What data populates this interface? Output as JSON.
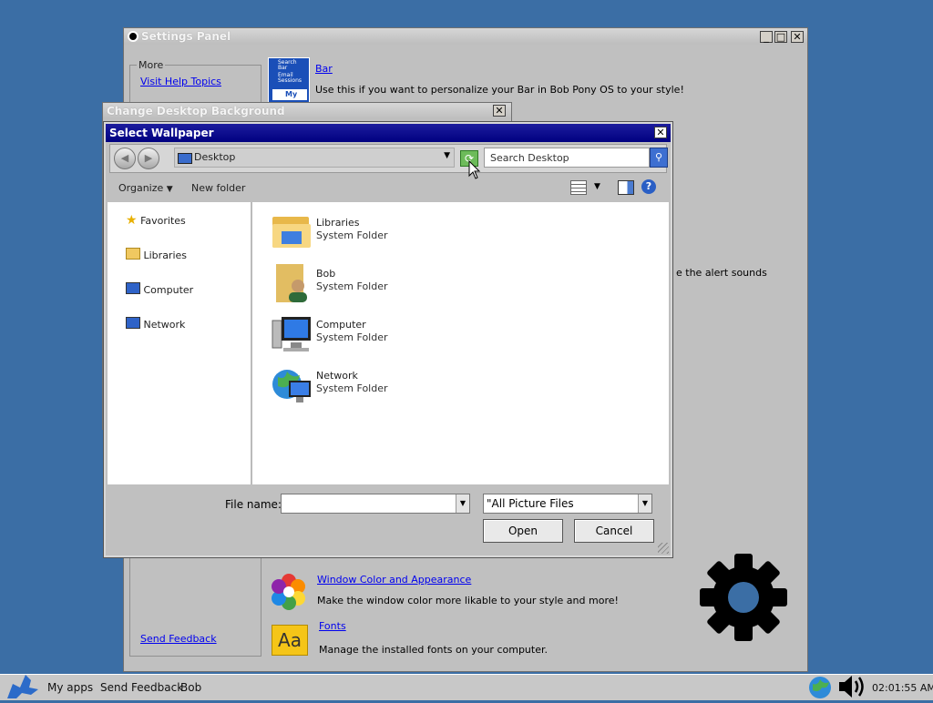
{
  "settings_panel": {
    "title": "Settings Panel",
    "more_label": "More",
    "help_link": "Visit Help Topics",
    "feedback_link": "Send Feedback",
    "bar_link": "Bar",
    "bar_desc": "Use this if you want to personalize your Bar in Bob Pony OS to your style!",
    "bar_thumb_top": "Search Bar",
    "bar_thumb_mid": "Email Sessions",
    "bar_thumb_bottom": "My ap",
    "alert_text": "e the alert sounds",
    "window_color_link": "Window Color and Appearance",
    "window_color_desc": "Make the window color more likable to your style and more!",
    "fonts_link": "Fonts",
    "fonts_desc": "Manage the installed fonts on your computer.",
    "fonts_icon_text": "Aa"
  },
  "change_bg": {
    "title": "Change Desktop Background"
  },
  "dialog": {
    "title": "Select Wallpaper",
    "location": "Desktop",
    "search_placeholder": "Search Desktop",
    "organize": "Organize",
    "new_folder": "New folder",
    "nav": [
      {
        "label": "Favorites",
        "icon": "star-icon"
      },
      {
        "label": "Libraries",
        "icon": "libraries-icon"
      },
      {
        "label": "Computer",
        "icon": "computer-icon"
      },
      {
        "label": "Network",
        "icon": "network-icon"
      }
    ],
    "files": [
      {
        "name": "Libraries",
        "type": "System Folder",
        "icon": "libraries-folder-icon"
      },
      {
        "name": "Bob",
        "type": "System Folder",
        "icon": "user-folder-icon"
      },
      {
        "name": "Computer",
        "type": "System Folder",
        "icon": "computer-icon"
      },
      {
        "name": "Network",
        "type": "System Folder",
        "icon": "network-globe-icon"
      }
    ],
    "file_name_label": "File name:",
    "file_name_value": "",
    "filter_value": "\"All Picture Files",
    "open": "Open",
    "cancel": "Cancel"
  },
  "taskbar": {
    "items": [
      "My apps",
      "Send Feedback",
      "Bob"
    ],
    "clock": "02:01:55 AM"
  }
}
